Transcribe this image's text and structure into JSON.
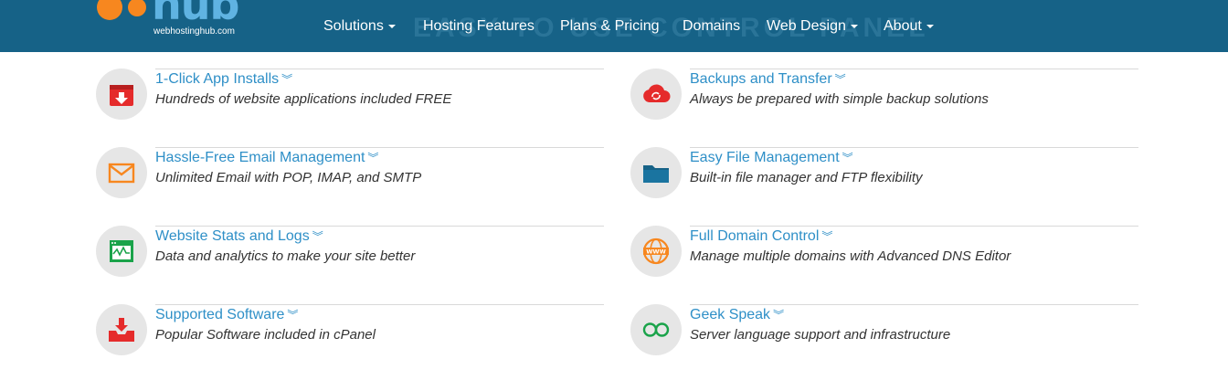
{
  "header": {
    "logo_word": "hub",
    "logo_sub": "webhostinghub.com",
    "background_text": "EASY TO USE CONTROL PANEL",
    "nav": [
      {
        "label": "Solutions",
        "caret": true
      },
      {
        "label": "Hosting Features",
        "caret": false
      },
      {
        "label": "Plans & Pricing",
        "caret": false
      },
      {
        "label": "Domains",
        "caret": false
      },
      {
        "label": "Web Design",
        "caret": true
      },
      {
        "label": "About",
        "caret": true
      }
    ]
  },
  "features": [
    {
      "title": "1-Click App Installs",
      "desc": "Hundreds of website applications included FREE",
      "icon": "app-install-icon",
      "color": "#e52b2b"
    },
    {
      "title": "Backups and Transfer",
      "desc": "Always be prepared with simple backup solutions",
      "icon": "cloud-sync-icon",
      "color": "#e52b2b"
    },
    {
      "title": "Hassle-Free Email Management",
      "desc": "Unlimited Email with POP, IMAP, and SMTP",
      "icon": "envelope-icon",
      "color": "#f7871f"
    },
    {
      "title": "Easy File Management",
      "desc": "Built-in file manager and FTP flexibility",
      "icon": "folder-icon",
      "color": "#166287"
    },
    {
      "title": "Website Stats and Logs",
      "desc": "Data and analytics to make your site better",
      "icon": "stats-window-icon",
      "color": "#1aa34a"
    },
    {
      "title": "Full Domain Control",
      "desc": "Manage multiple domains with Advanced DNS Editor",
      "icon": "www-globe-icon",
      "color": "#f7871f"
    },
    {
      "title": "Supported Software",
      "desc": "Popular Software included in cPanel",
      "icon": "download-tray-icon",
      "color": "#e52b2b"
    },
    {
      "title": "Geek Speak",
      "desc": "Server language support and infrastructure",
      "icon": "geek-glasses-icon",
      "color": "#1aa34a"
    }
  ]
}
